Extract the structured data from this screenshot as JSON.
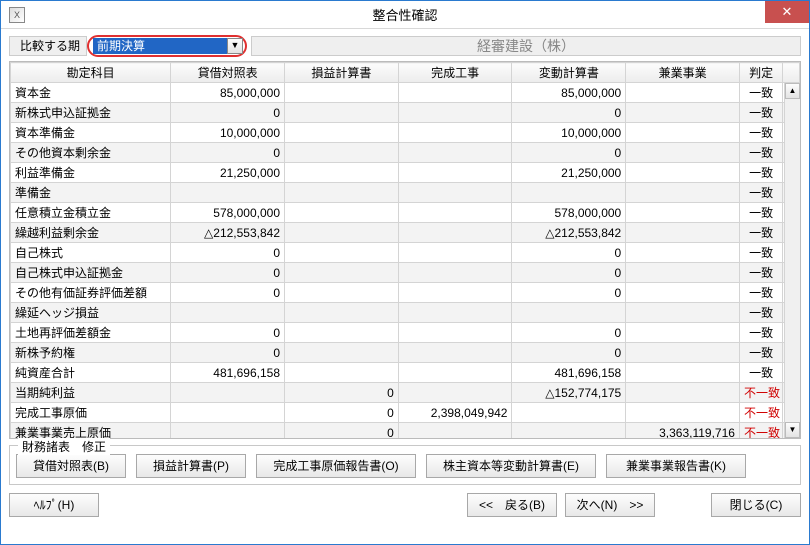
{
  "window": {
    "title": "整合性確認",
    "sysicon": "X",
    "close": "✕"
  },
  "toprow": {
    "compare_label": "比較する期",
    "combo_value": "前期決算",
    "company": "経審建設（株）"
  },
  "columns": [
    "勘定科目",
    "貸借対照表",
    "損益計算書",
    "完成工事",
    "変動計算書",
    "兼業事業",
    "判定"
  ],
  "rows": [
    {
      "name": "資本金",
      "bs": "85,000,000",
      "pl": "",
      "cw": "",
      "cb": "85,000,000",
      "kb": "",
      "judge": "一致",
      "ok": true
    },
    {
      "name": "新株式申込証拠金",
      "bs": "0",
      "pl": "",
      "cw": "",
      "cb": "0",
      "kb": "",
      "judge": "一致",
      "ok": true
    },
    {
      "name": "資本準備金",
      "bs": "10,000,000",
      "pl": "",
      "cw": "",
      "cb": "10,000,000",
      "kb": "",
      "judge": "一致",
      "ok": true
    },
    {
      "name": "その他資本剰余金",
      "bs": "0",
      "pl": "",
      "cw": "",
      "cb": "0",
      "kb": "",
      "judge": "一致",
      "ok": true
    },
    {
      "name": "利益準備金",
      "bs": "21,250,000",
      "pl": "",
      "cw": "",
      "cb": "21,250,000",
      "kb": "",
      "judge": "一致",
      "ok": true
    },
    {
      "name": "準備金",
      "bs": "",
      "pl": "",
      "cw": "",
      "cb": "",
      "kb": "",
      "judge": "一致",
      "ok": true
    },
    {
      "name": "任意積立金積立金",
      "bs": "578,000,000",
      "pl": "",
      "cw": "",
      "cb": "578,000,000",
      "kb": "",
      "judge": "一致",
      "ok": true
    },
    {
      "name": "繰越利益剰余金",
      "bs": "△212,553,842",
      "pl": "",
      "cw": "",
      "cb": "△212,553,842",
      "kb": "",
      "judge": "一致",
      "ok": true
    },
    {
      "name": "自己株式",
      "bs": "0",
      "pl": "",
      "cw": "",
      "cb": "0",
      "kb": "",
      "judge": "一致",
      "ok": true
    },
    {
      "name": "自己株式申込証拠金",
      "bs": "0",
      "pl": "",
      "cw": "",
      "cb": "0",
      "kb": "",
      "judge": "一致",
      "ok": true
    },
    {
      "name": "その他有価証券評価差額",
      "bs": "0",
      "pl": "",
      "cw": "",
      "cb": "0",
      "kb": "",
      "judge": "一致",
      "ok": true
    },
    {
      "name": "繰延ヘッジ損益",
      "bs": "",
      "pl": "",
      "cw": "",
      "cb": "",
      "kb": "",
      "judge": "一致",
      "ok": true
    },
    {
      "name": "土地再評価差額金",
      "bs": "0",
      "pl": "",
      "cw": "",
      "cb": "0",
      "kb": "",
      "judge": "一致",
      "ok": true
    },
    {
      "name": "新株予約権",
      "bs": "0",
      "pl": "",
      "cw": "",
      "cb": "0",
      "kb": "",
      "judge": "一致",
      "ok": true
    },
    {
      "name": "純資産合計",
      "bs": "481,696,158",
      "pl": "",
      "cw": "",
      "cb": "481,696,158",
      "kb": "",
      "judge": "一致",
      "ok": true
    },
    {
      "name": "当期純利益",
      "bs": "",
      "pl": "0",
      "cw": "",
      "cb": "△152,774,175",
      "kb": "",
      "judge": "不一致",
      "ok": false
    },
    {
      "name": "完成工事原価",
      "bs": "",
      "pl": "0",
      "cw": "2,398,049,942",
      "cb": "",
      "kb": "",
      "judge": "不一致",
      "ok": false
    },
    {
      "name": "兼業事業売上原価",
      "bs": "",
      "pl": "0",
      "cw": "",
      "cb": "",
      "kb": "3,363,119,716",
      "judge": "不一致",
      "ok": false
    }
  ],
  "groupbox": {
    "legend": "財務諸表　修正",
    "buttons": {
      "bs": "貸借対照表(B)",
      "pl": "損益計算書(P)",
      "cw": "完成工事原価報告書(O)",
      "cb": "株主資本等変動計算書(E)",
      "kb": "兼業事業報告書(K)"
    }
  },
  "bottom": {
    "help": "ﾍﾙﾌﾟ(H)",
    "back": "<<　戻る(B)",
    "next": "次へ(N)　>>",
    "close": "閉じる(C)"
  }
}
